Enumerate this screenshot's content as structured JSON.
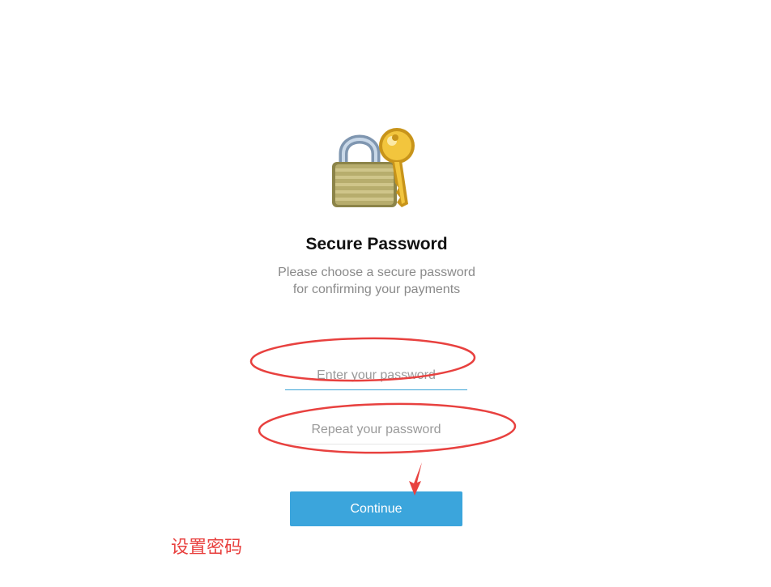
{
  "header": {
    "title": "Secure Password",
    "subtitle_line1": "Please choose a secure password",
    "subtitle_line2": "for confirming your payments"
  },
  "form": {
    "password_placeholder": "Enter your password",
    "repeat_placeholder": "Repeat your password",
    "continue_label": "Continue"
  },
  "annotation": {
    "note": "设置密码",
    "color": "#e8413f"
  },
  "colors": {
    "accent": "#3ba5dc",
    "input_underline": "#3ba3d6"
  },
  "icons": {
    "hero": "lock-with-key-icon"
  }
}
